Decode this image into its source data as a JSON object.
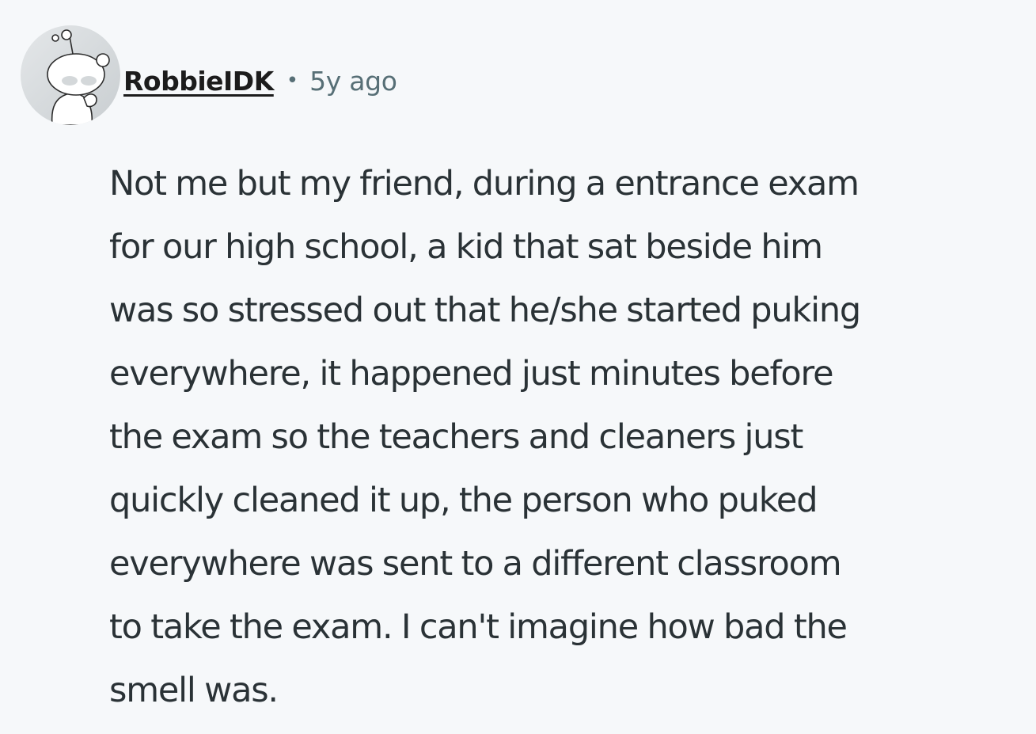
{
  "comment": {
    "avatar_icon": "reddit-snoo-avatar-icon",
    "username": "RobbieIDK",
    "separator": "•",
    "timestamp": "5y ago",
    "body_lines": [
      "Not me but my friend, during a entrance exam",
      "for our high school, a kid that sat beside him",
      "was so stressed out that he/she started puking",
      "everywhere, it happened just minutes before",
      "the exam so the teachers and cleaners just",
      "quickly cleaned it up, the person who puked",
      "everywhere was sent to a different classroom",
      "to take the exam. I can't imagine how bad the",
      "smell was."
    ]
  },
  "colors": {
    "background": "#f6f8fa",
    "username": "#1c1c1c",
    "meta": "#576f76",
    "body": "#2a3236"
  }
}
